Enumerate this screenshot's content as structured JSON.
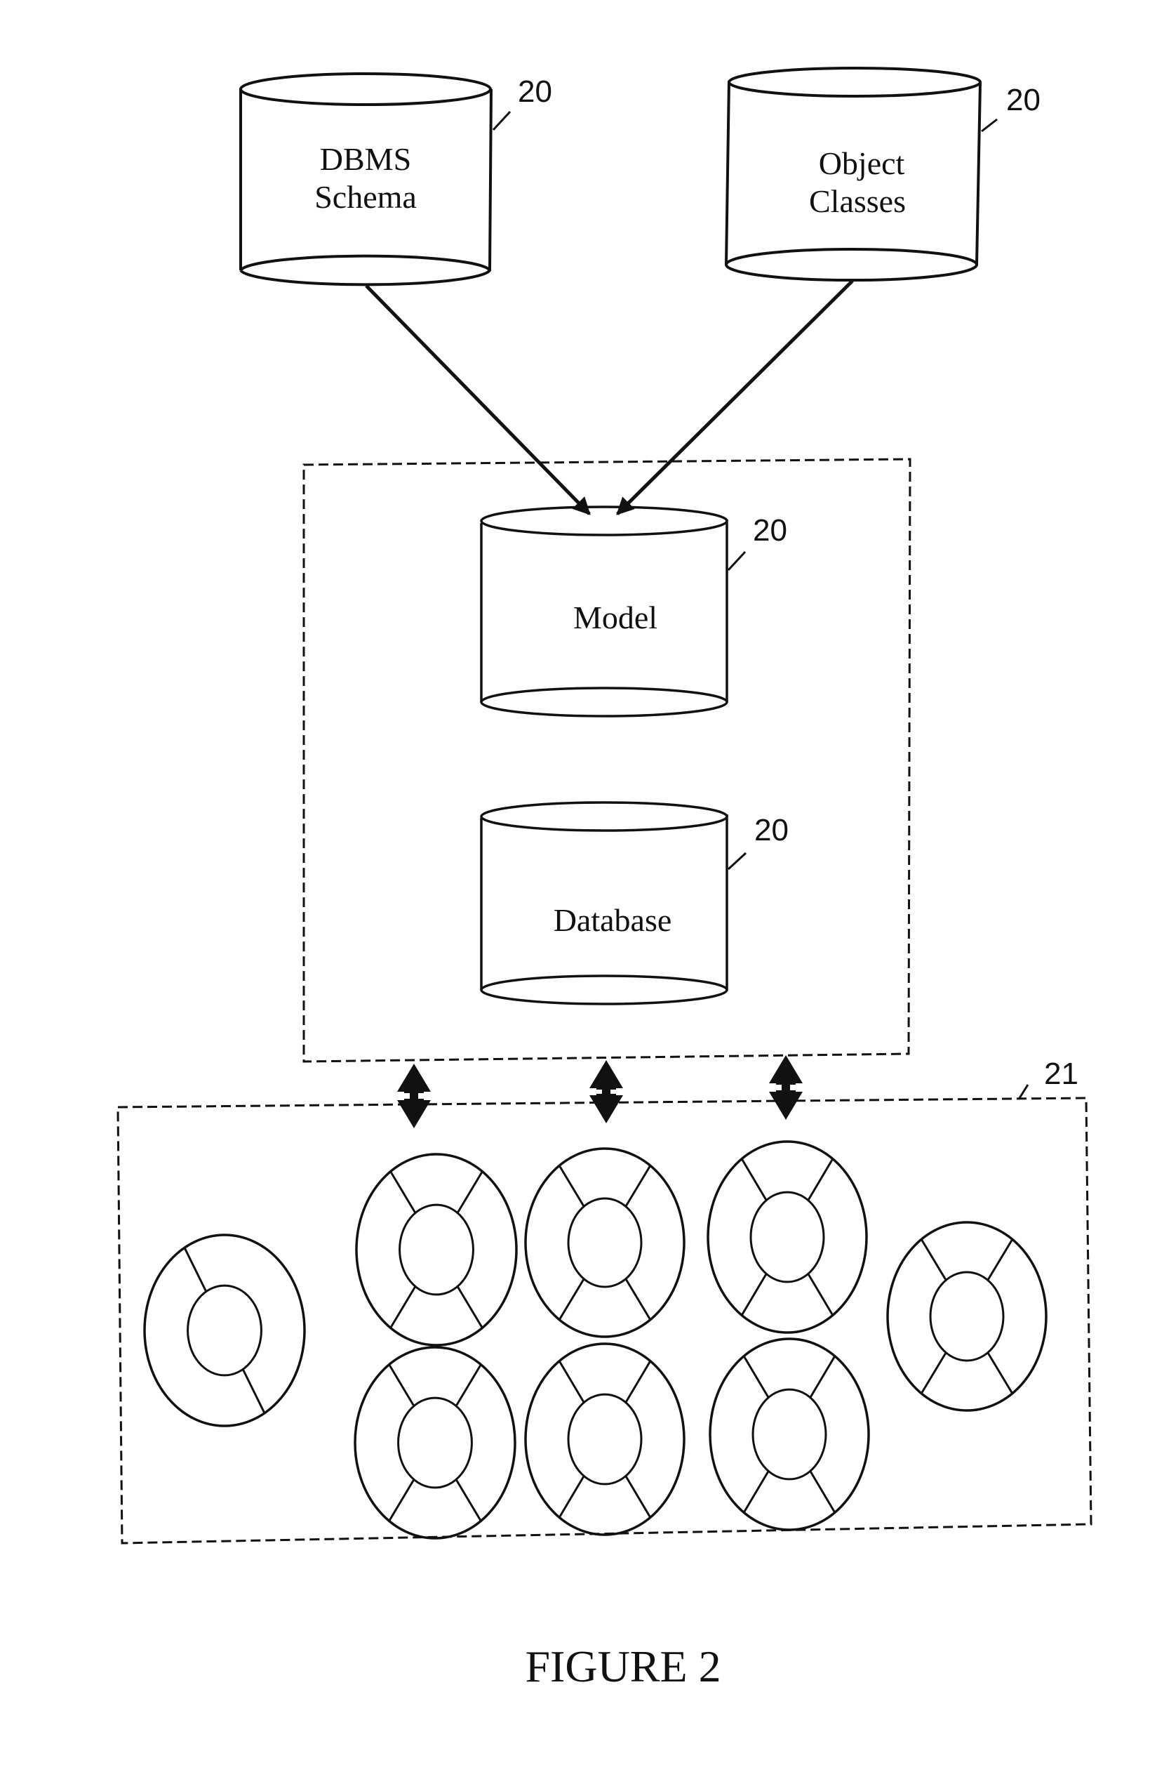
{
  "figure": {
    "caption": "FIGURE 2",
    "ink_color": "#111111",
    "background": "#ffffff"
  },
  "sources": [
    {
      "id": "dbms-schema",
      "lines": [
        "DBMS",
        "Schema"
      ],
      "ref": "20"
    },
    {
      "id": "object-classes",
      "lines": [
        "Object",
        "Classes"
      ],
      "ref": "20"
    }
  ],
  "system_box": {
    "style": "dashed",
    "stores": [
      {
        "id": "model",
        "label": "Model",
        "ref": "20"
      },
      {
        "id": "database",
        "label": "Database",
        "ref": "20"
      }
    ]
  },
  "connections": {
    "source_arrows": [
      {
        "from": "dbms-schema",
        "to": "model",
        "type": "arrow"
      },
      {
        "from": "object-classes",
        "to": "model",
        "type": "arrow"
      }
    ],
    "bidirectional_arrows_count": 3
  },
  "client_box": {
    "ref": "21",
    "style": "dashed",
    "nodes": [
      {
        "id": "node-1",
        "spokes": 2
      },
      {
        "id": "node-2",
        "spokes": 4
      },
      {
        "id": "node-3",
        "spokes": 4
      },
      {
        "id": "node-4",
        "spokes": 4
      },
      {
        "id": "node-5",
        "spokes": 4
      },
      {
        "id": "node-6",
        "spokes": 4
      },
      {
        "id": "node-7",
        "spokes": 4
      },
      {
        "id": "node-8",
        "spokes": 4
      }
    ]
  }
}
